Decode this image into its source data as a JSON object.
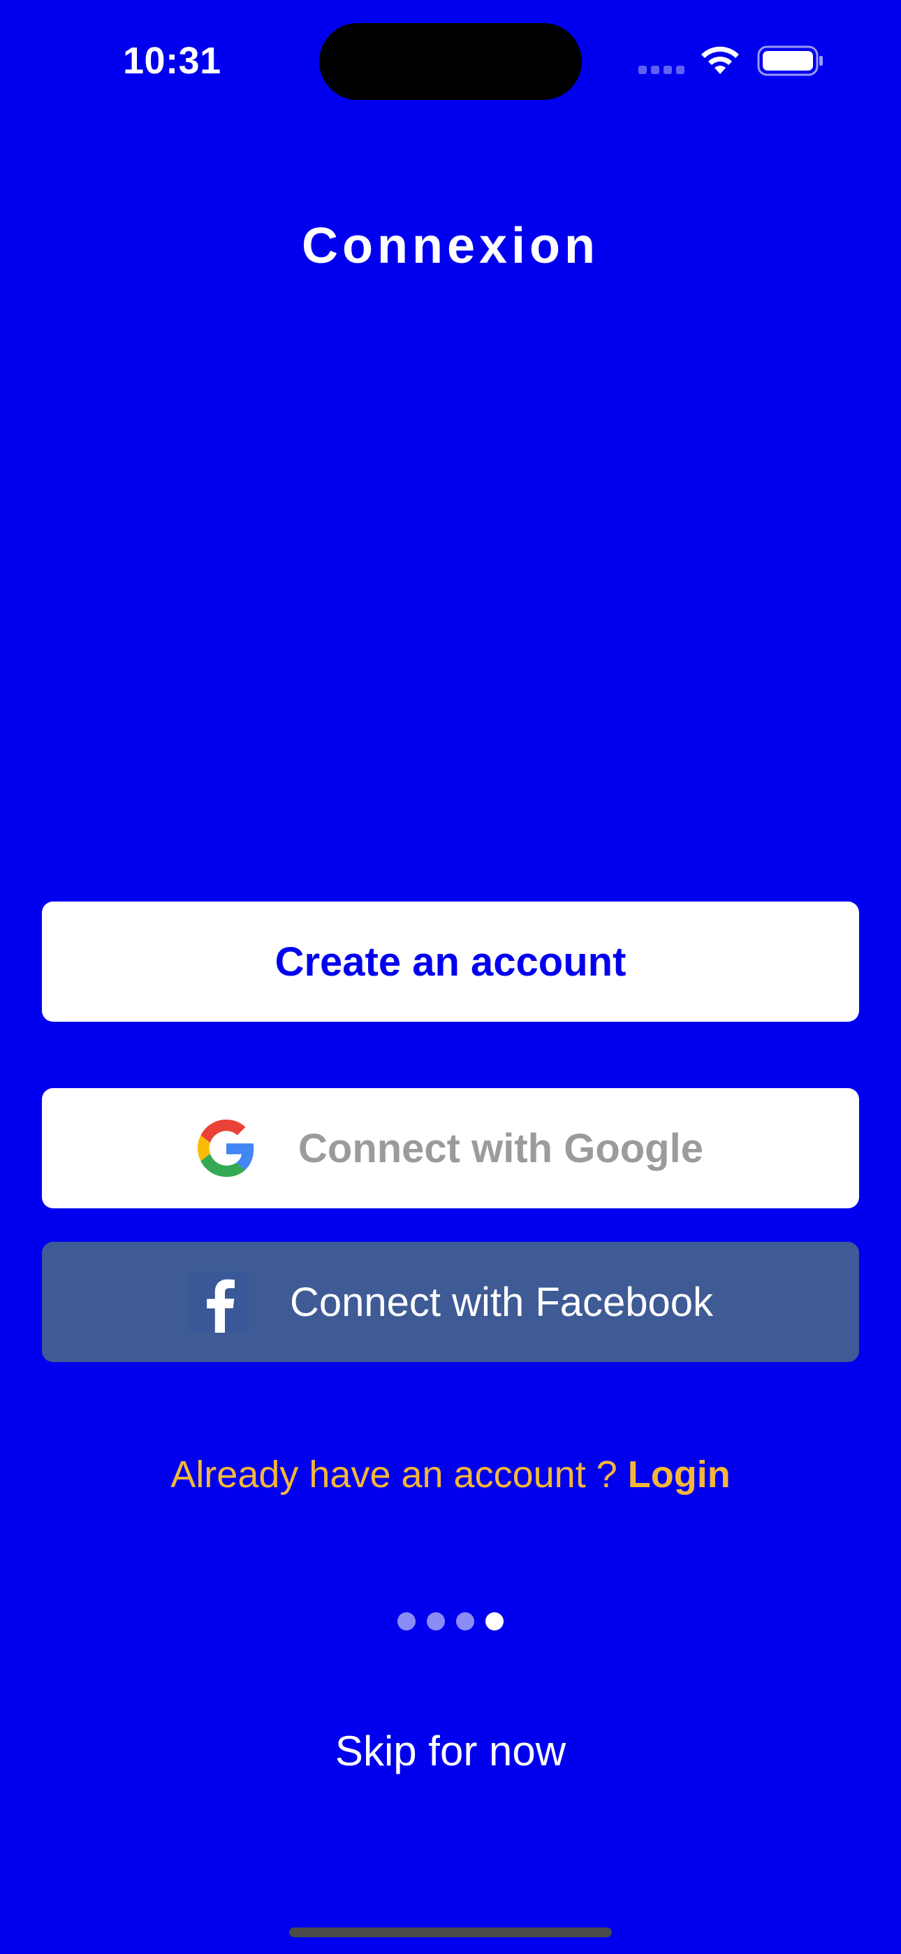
{
  "status_bar": {
    "time": "10:31"
  },
  "title": "Connexion",
  "buttons": {
    "create_account": "Create an account",
    "google": "Connect with Google",
    "facebook": "Connect with Facebook"
  },
  "login_prompt": {
    "text": "Already have an account ? ",
    "link": "Login"
  },
  "pagination": {
    "total": 4,
    "active_index": 3
  },
  "skip_label": "Skip for now",
  "colors": {
    "background": "#0000EE",
    "facebook": "#3F5B96",
    "accent": "#F4B63A",
    "button_text_blue": "#0000EE",
    "google_text": "#9B9B9B"
  },
  "icons": [
    "cellular-signal-icon",
    "wifi-icon",
    "battery-icon",
    "google-icon",
    "facebook-icon"
  ]
}
